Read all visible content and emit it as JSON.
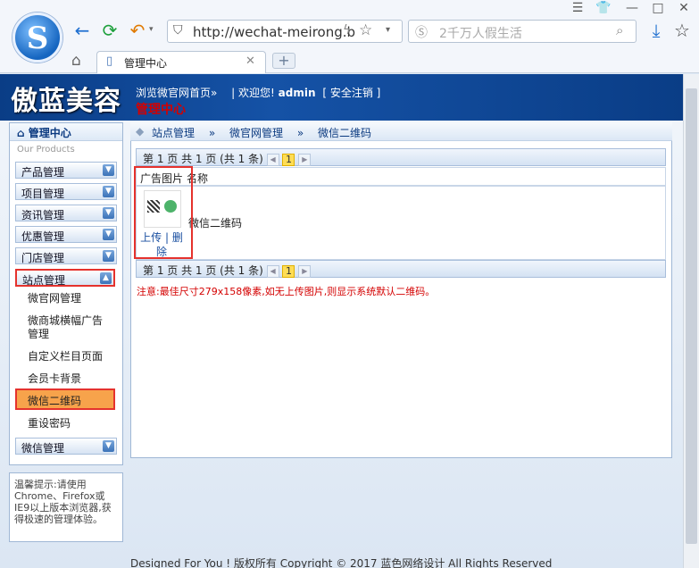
{
  "browser": {
    "address_url": "http://wechat-meirong.b",
    "search_placeholder": "2千万人假生活",
    "tab_title": "管理中心",
    "new_tab_label": "+",
    "window_buttons": [
      "☰",
      "👕",
      "—",
      "□",
      "✕"
    ]
  },
  "header": {
    "brand": "傲蓝美容",
    "browse_link": "浏览微官网首页»",
    "welcome": "| 欢迎您!",
    "user": "admin",
    "logout": "[ 安全注销 ]",
    "subtitle": "管理中心"
  },
  "sidebar": {
    "title": "管理中心",
    "subtitle": "Our Products",
    "menus": [
      {
        "label": "产品管理"
      },
      {
        "label": "项目管理"
      },
      {
        "label": "资讯管理"
      },
      {
        "label": "优惠管理"
      },
      {
        "label": "门店管理"
      },
      {
        "label": "站点管理"
      }
    ],
    "submenus": [
      {
        "label": "微官网管理"
      },
      {
        "label": "微商城横幅广告管理"
      },
      {
        "label": "自定义栏目页面"
      },
      {
        "label": "会员卡背景"
      },
      {
        "label": "微信二维码"
      },
      {
        "label": "重设密码"
      }
    ],
    "last_menu": "微信管理",
    "hint": "温馨提示:请使用Chrome、Firefox或IE9以上版本浏览器,获得极速的管理体验。"
  },
  "breadcrumb": {
    "item1": "站点管理",
    "sep": "»",
    "item2": "微官网管理",
    "item3": "微信二维码"
  },
  "table": {
    "pager_text": "第 1 页 共 1 页 (共 1 条)",
    "page_num": "1",
    "col_image": "广告图片",
    "col_name": "名称",
    "row_name": "微信二维码",
    "upload": "上传",
    "delete": "删除",
    "divider": "|"
  },
  "note": "注意:最佳尺寸279x158像素,如无上传图片,则显示系统默认二维码。",
  "footer": "Designed For You ! 版权所有 Copyright © 2017 蓝色网络设计 All Rights Reserved"
}
